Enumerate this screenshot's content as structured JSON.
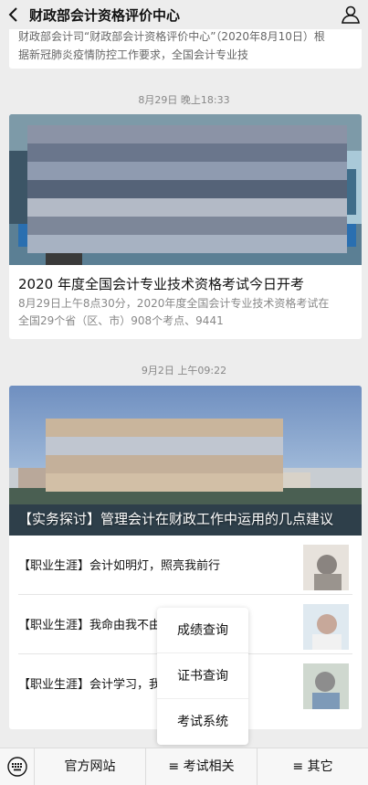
{
  "header": {
    "title": "财政部会计资格评价中心",
    "back_icon": "chevron-left-icon",
    "profile_icon": "person-icon"
  },
  "card0": {
    "line1": "财政部会计司“财政部会计资格评价中心”（2020年8月10日）根",
    "line2": "据新冠肺炎疫情防控工作要求，全国会计专业技"
  },
  "timestamps": {
    "t1": "8月29日 晚上18:33",
    "t2": "9月2日 上午09:22"
  },
  "article1": {
    "title": "2020 年度全国会计专业技术资格考试今日开考",
    "desc_line1": "8月29日上午8点30分，2020年度全国会计专业技术资格考试在",
    "desc_line2": "全国29个省（区、市）908个考点、9441"
  },
  "article2": {
    "title": "【实务探讨】管理会计在财政工作中运用的几点建议",
    "items": [
      {
        "title": "【职业生涯】会计如明灯，照亮我前行"
      },
      {
        "title": "【职业生涯】我命由我不由"
      },
      {
        "title": "【职业生涯】会计学习，我"
      }
    ]
  },
  "popup_menu": {
    "items": [
      "成绩查询",
      "证书查询",
      "考试系统"
    ]
  },
  "bottom_bar": {
    "keyboard_icon": "keyboard-icon",
    "menu1": "官方网站",
    "menu2": "≡ 考试相关",
    "menu3": "≡ 其它"
  },
  "colors": {
    "background": "#ededed",
    "card": "#ffffff",
    "muted_text": "#888888"
  }
}
